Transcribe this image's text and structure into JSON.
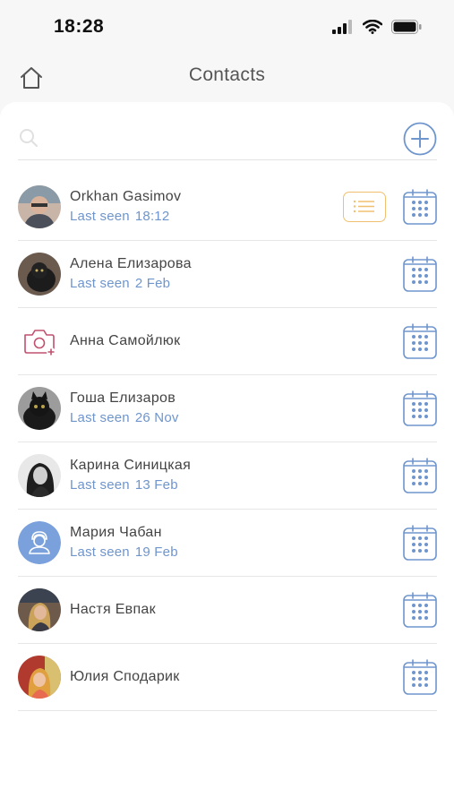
{
  "status": {
    "time": "18:28"
  },
  "header": {
    "title": "Contacts"
  },
  "search": {
    "placeholder": ""
  },
  "contacts": [
    {
      "name": "Orkhan Gasimov",
      "last_seen_label": "Last seen",
      "last_seen_value": "18:12",
      "avatar": "photo-man-glasses",
      "has_notes": true
    },
    {
      "name": "Алена Елизарова",
      "last_seen_label": "Last seen",
      "last_seen_value": "2 Feb",
      "avatar": "photo-black-cat",
      "has_notes": false
    },
    {
      "name": "Анна Самойлюк",
      "last_seen_label": "",
      "last_seen_value": "",
      "avatar": "add-photo-icon",
      "has_notes": false
    },
    {
      "name": "Гоша Елизаров",
      "last_seen_label": "Last seen",
      "last_seen_value": "26 Nov",
      "avatar": "photo-black-cat-2",
      "has_notes": false
    },
    {
      "name": "Карина Синицкая",
      "last_seen_label": "Last seen",
      "last_seen_value": "13 Feb",
      "avatar": "photo-woman-bw",
      "has_notes": false
    },
    {
      "name": "Мария Чабан",
      "last_seen_label": "Last seen",
      "last_seen_value": "19 Feb",
      "avatar": "default-user-icon",
      "has_notes": false
    },
    {
      "name": "Настя Евпак",
      "last_seen_label": "",
      "last_seen_value": "",
      "avatar": "photo-woman-blonde",
      "has_notes": false
    },
    {
      "name": "Юлия Сподарик",
      "last_seen_label": "",
      "last_seen_value": "",
      "avatar": "photo-woman-red",
      "has_notes": false
    }
  ],
  "colors": {
    "accent": "#6f95cd",
    "notes": "#f0c070",
    "camera": "#c0506e",
    "default_avatar": "#7aa1dc"
  }
}
